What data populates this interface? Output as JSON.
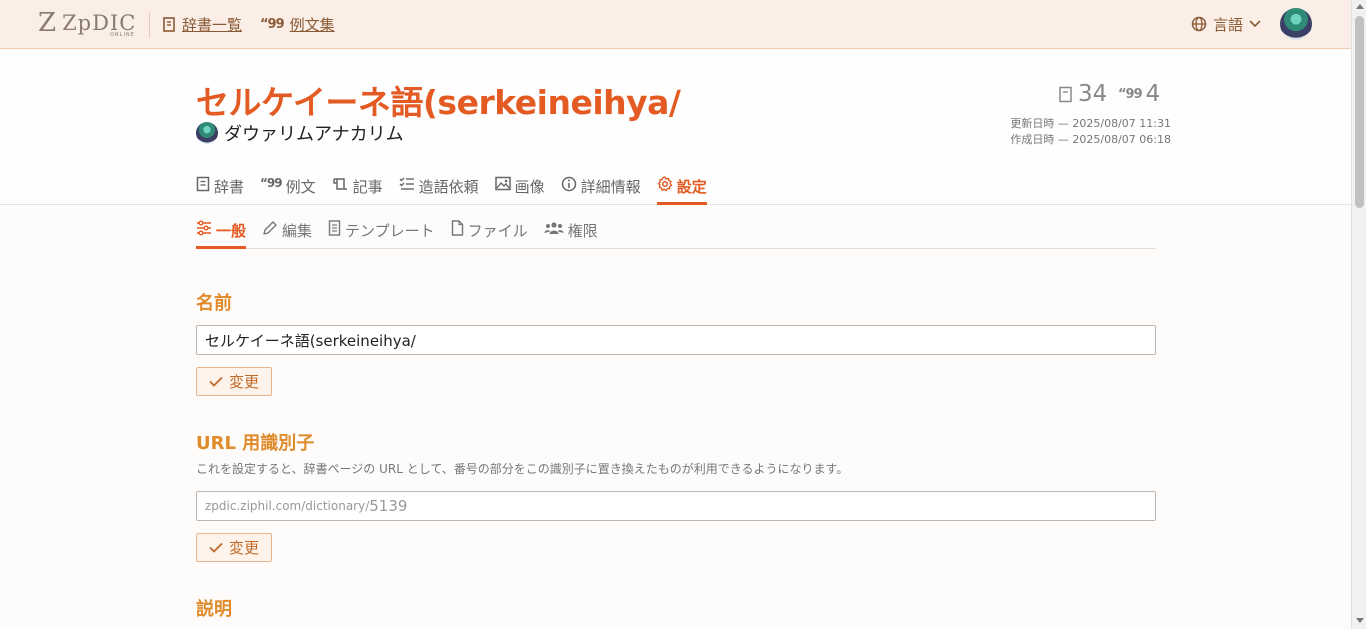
{
  "header": {
    "logo_text": "ZpDIC",
    "logo_sub": "ONLINE",
    "nav": [
      {
        "label": "辞書一覧",
        "icon": "book-icon"
      },
      {
        "label": "例文集",
        "icon": "quote-icon"
      }
    ],
    "language_label": "言語"
  },
  "dictionary": {
    "title": "セルケイーネ語(serkeineihya/",
    "owner": "ダウァリムアナカリム",
    "word_count": "34",
    "example_count": "4",
    "updated": "更新日時 — 2025/08/07 11:31",
    "created": "作成日時 — 2025/08/07 06:18"
  },
  "tabs": [
    {
      "label": "辞書",
      "icon": "book-icon",
      "active": false
    },
    {
      "label": "例文",
      "icon": "quote-icon",
      "active": false
    },
    {
      "label": "記事",
      "icon": "scroll-icon",
      "active": false
    },
    {
      "label": "造語依頼",
      "icon": "list-check-icon",
      "active": false
    },
    {
      "label": "画像",
      "icon": "image-icon",
      "active": false
    },
    {
      "label": "詳細情報",
      "icon": "info-icon",
      "active": false
    },
    {
      "label": "設定",
      "icon": "gear-icon",
      "active": true
    }
  ],
  "subtabs": [
    {
      "label": "一般",
      "icon": "sliders-icon",
      "active": true
    },
    {
      "label": "編集",
      "icon": "pencil-icon",
      "active": false
    },
    {
      "label": "テンプレート",
      "icon": "document-icon",
      "active": false
    },
    {
      "label": "ファイル",
      "icon": "file-icon",
      "active": false
    },
    {
      "label": "権限",
      "icon": "users-icon",
      "active": false
    }
  ],
  "sections": {
    "name": {
      "title": "名前",
      "value": "セルケイーネ語(serkeineihya/",
      "button_label": "変更"
    },
    "url": {
      "title": "URL 用識別子",
      "description": "これを設定すると、辞書ページの URL として、番号の部分をこの識別子に置き換えたものが利用できるようになります。",
      "prefix": "zpdic.ziphil.com/dictionary/",
      "placeholder": "5139",
      "button_label": "変更"
    },
    "explanation": {
      "title": "説明"
    }
  },
  "colors": {
    "accent": "#e35b22",
    "section_title": "#e08a2a",
    "header_bg": "#fbeee6"
  }
}
